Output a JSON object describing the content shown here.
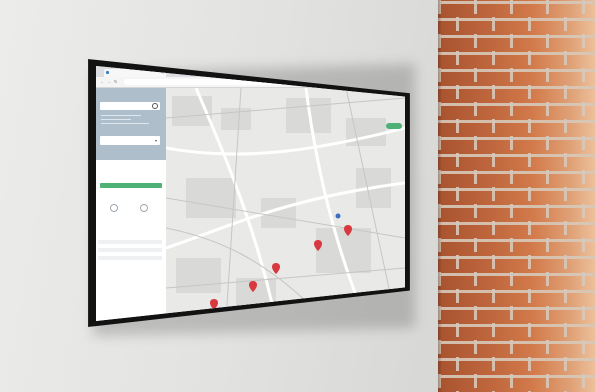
{
  "scene": {
    "wall_color": "#e3e3e1",
    "brick_color": "#c4683f",
    "tv_bezel_color": "#121212"
  },
  "browser": {
    "tab_title": "",
    "url": ""
  },
  "sidebar": {
    "search_value": "",
    "dropdown_value": "",
    "go_button": "",
    "modes": [
      "",
      ""
    ],
    "results": []
  },
  "map": {
    "button_label": "",
    "accent": "#4fb176",
    "marker_color": "#d8383f"
  }
}
